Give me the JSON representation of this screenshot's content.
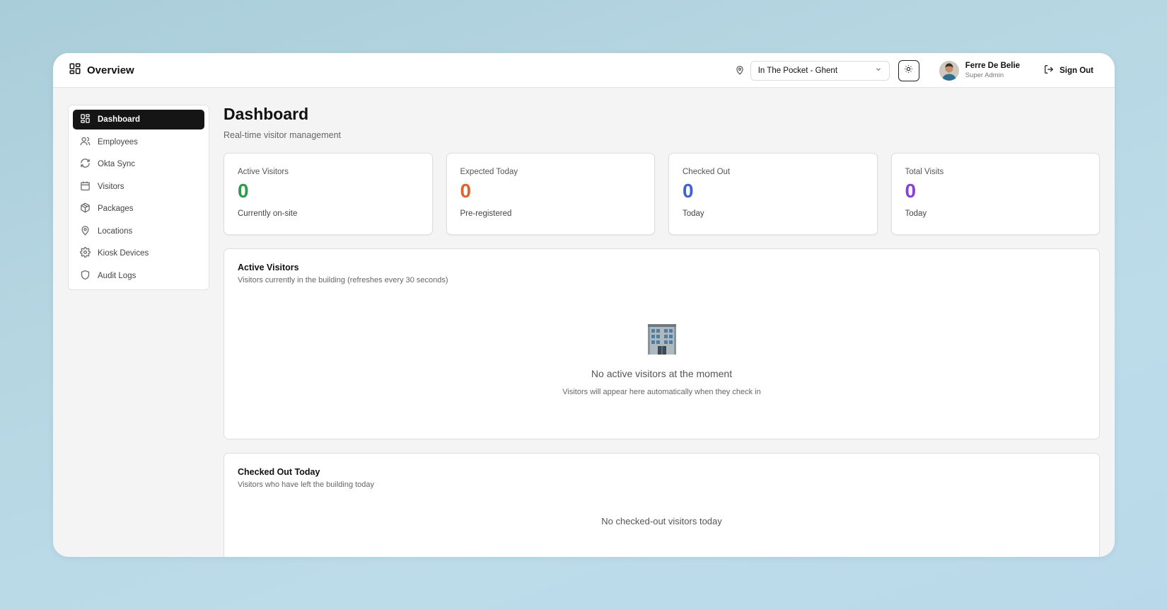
{
  "header": {
    "title": "Overview",
    "location_select": {
      "value": "In The Pocket - Ghent"
    },
    "user": {
      "name": "Ferre De Belie",
      "role": "Super Admin"
    },
    "sign_out_label": "Sign Out"
  },
  "sidebar": {
    "items": [
      {
        "label": "Dashboard",
        "icon": "dashboard-icon",
        "active": true
      },
      {
        "label": "Employees",
        "icon": "users-icon",
        "active": false
      },
      {
        "label": "Okta Sync",
        "icon": "sync-icon",
        "active": false
      },
      {
        "label": "Visitors",
        "icon": "calendar-icon",
        "active": false
      },
      {
        "label": "Packages",
        "icon": "package-icon",
        "active": false
      },
      {
        "label": "Locations",
        "icon": "map-pin-icon",
        "active": false
      },
      {
        "label": "Kiosk Devices",
        "icon": "gear-icon",
        "active": false
      },
      {
        "label": "Audit Logs",
        "icon": "shield-icon",
        "active": false
      }
    ]
  },
  "page": {
    "title": "Dashboard",
    "subtitle": "Real-time visitor management"
  },
  "stats": [
    {
      "label": "Active Visitors",
      "value": "0",
      "note": "Currently on-site",
      "color": "#2e9a4b"
    },
    {
      "label": "Expected Today",
      "value": "0",
      "note": "Pre-registered",
      "color": "#e2622f"
    },
    {
      "label": "Checked Out",
      "value": "0",
      "note": "Today",
      "color": "#3c63d6"
    },
    {
      "label": "Total Visits",
      "value": "0",
      "note": "Today",
      "color": "#8a3fd9"
    }
  ],
  "active_visitors_panel": {
    "title": "Active Visitors",
    "subtitle": "Visitors currently in the building (refreshes every 30 seconds)",
    "empty_icon": "office-building-icon",
    "empty_title": "No active visitors at the moment",
    "empty_subtitle": "Visitors will appear here automatically when they check in"
  },
  "checked_out_panel": {
    "title": "Checked Out Today",
    "subtitle": "Visitors who have left the building today",
    "empty_title": "No checked-out visitors today"
  }
}
